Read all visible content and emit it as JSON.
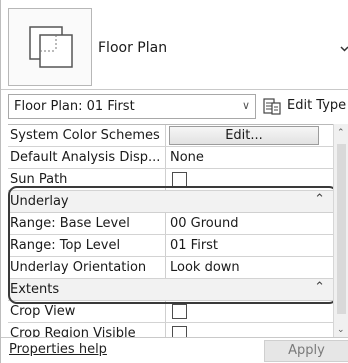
{
  "type_selector": {
    "type_name": "Floor Plan"
  },
  "instance_selector": {
    "value": "Floor Plan: 01 First",
    "edit_type_label": "Edit Type"
  },
  "properties": {
    "top_rows": [
      {
        "name": "System Color Schemes",
        "value": "Edit..."
      },
      {
        "name": "Default Analysis Disp...",
        "value": "None"
      },
      {
        "name": "Sun Path",
        "value": ""
      }
    ],
    "underlay_group": {
      "label": "Underlay",
      "rows": [
        {
          "name": "Range: Base Level",
          "value": "00 Ground"
        },
        {
          "name": "Range: Top Level",
          "value": "01 First"
        },
        {
          "name": "Underlay Orientation",
          "value": "Look down"
        }
      ]
    },
    "extents_group": {
      "label": "Extents",
      "rows": [
        {
          "name": "Crop View",
          "value": ""
        },
        {
          "name": "Crop Region Visible",
          "value": ""
        }
      ]
    }
  },
  "footer": {
    "help_link": "Properties help",
    "apply_label": "Apply"
  },
  "icons": {
    "collapse": "double-chevron-up-icon",
    "dropdown": "chevron-down-icon",
    "edit_type": "edit-type-icon"
  }
}
